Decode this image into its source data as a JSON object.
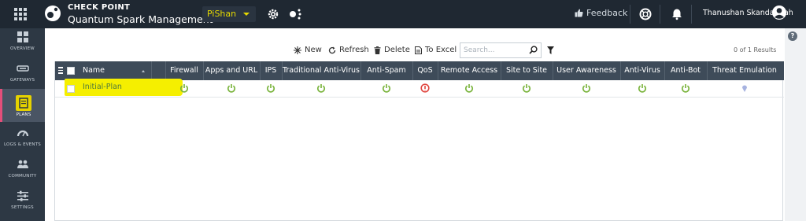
{
  "topbar": {
    "brand_top": "CHECK POINT",
    "brand_bottom": "Quantum Spark Management",
    "gateway_selected": "PiShan",
    "feedback_label": "Feedback",
    "user_name": "Thanushan Skandarajah"
  },
  "sidebar": {
    "items": [
      {
        "label": "OVERVIEW",
        "icon": "dashboard-icon"
      },
      {
        "label": "GATEWAYS",
        "icon": "gateway-icon"
      },
      {
        "label": "PLANS",
        "icon": "plans-icon",
        "active": true
      },
      {
        "label": "LOGS & EVENTS",
        "icon": "gauge-icon"
      },
      {
        "label": "COMMUNITY",
        "icon": "people-icon"
      },
      {
        "label": "SETTINGS",
        "icon": "sliders-icon"
      }
    ]
  },
  "toolbar": {
    "new_label": "New",
    "refresh_label": "Refresh",
    "delete_label": "Delete",
    "excel_label": "To Excel",
    "search_placeholder": "Search...",
    "results_text": "0 of 1 Results"
  },
  "table": {
    "columns": [
      "Name",
      "Firewall",
      "Apps and URL",
      "IPS",
      "Traditional Anti-Virus",
      "Anti-Spam",
      "QoS",
      "Remote Access",
      "Site to Site",
      "User Awareness",
      "Anti-Virus",
      "Anti-Bot",
      "Threat Emulation"
    ],
    "rows": [
      {
        "name": "Initial-Plan",
        "statuses": [
          "on",
          "on",
          "on",
          "on",
          "on",
          "off",
          "on",
          "on",
          "on",
          "on",
          "on",
          "pending"
        ]
      }
    ]
  },
  "colors": {
    "status_on": "#7cb540",
    "status_off": "#e0453f",
    "status_pending": "#a7b3e0",
    "highlight": "#f5ef00",
    "accent_active": "#e54e7a"
  }
}
